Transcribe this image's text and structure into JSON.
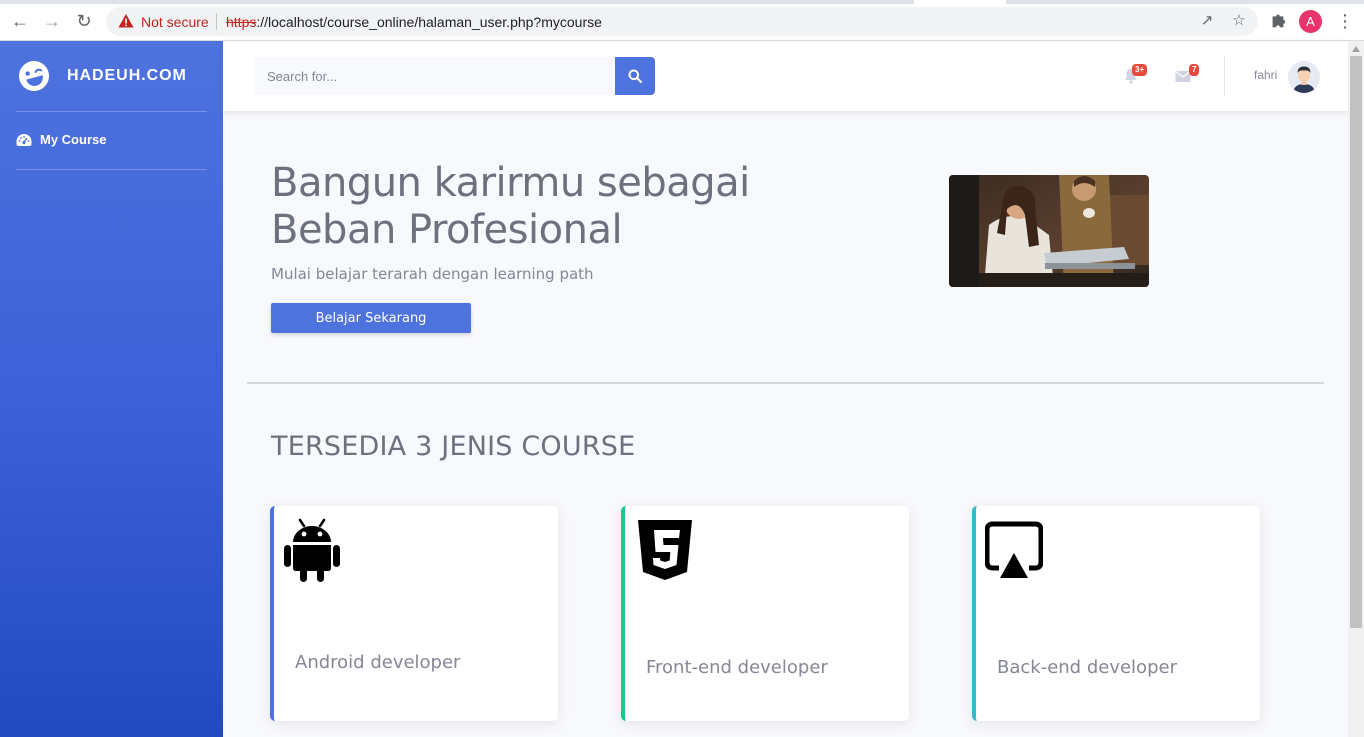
{
  "browser": {
    "security_label": "Not secure",
    "url_scheme": "https",
    "url_rest": "://localhost/course_online/halaman_user.php?mycourse",
    "profile_initial": "A"
  },
  "sidebar": {
    "brand": "HADEUH.COM",
    "items": [
      {
        "label": "My Course",
        "icon": "tachometer-icon"
      }
    ]
  },
  "topbar": {
    "search_placeholder": "Search for...",
    "alerts_badge": "3+",
    "messages_badge": "7",
    "user_name": "fahri"
  },
  "hero": {
    "title_line1": "Bangun karirmu sebagai",
    "title_line2": "Beban Profesional",
    "subtitle": "Mulai belajar terarah dengan learning path",
    "cta_label": "Belajar Sekarang"
  },
  "courses": {
    "heading": "TERSEDIA 3 JENIS COURSE",
    "items": [
      {
        "label": "Android developer",
        "icon": "android-icon",
        "accent": "#4e73df"
      },
      {
        "label": "Front-end developer",
        "icon": "html5-icon",
        "accent": "#1cc88a"
      },
      {
        "label": "Back-end developer",
        "icon": "airplay-icon",
        "accent": "#36b9cc"
      }
    ]
  },
  "colors": {
    "primary": "#4e73df",
    "success": "#1cc88a",
    "info": "#36b9cc",
    "danger": "#e74a3b"
  }
}
